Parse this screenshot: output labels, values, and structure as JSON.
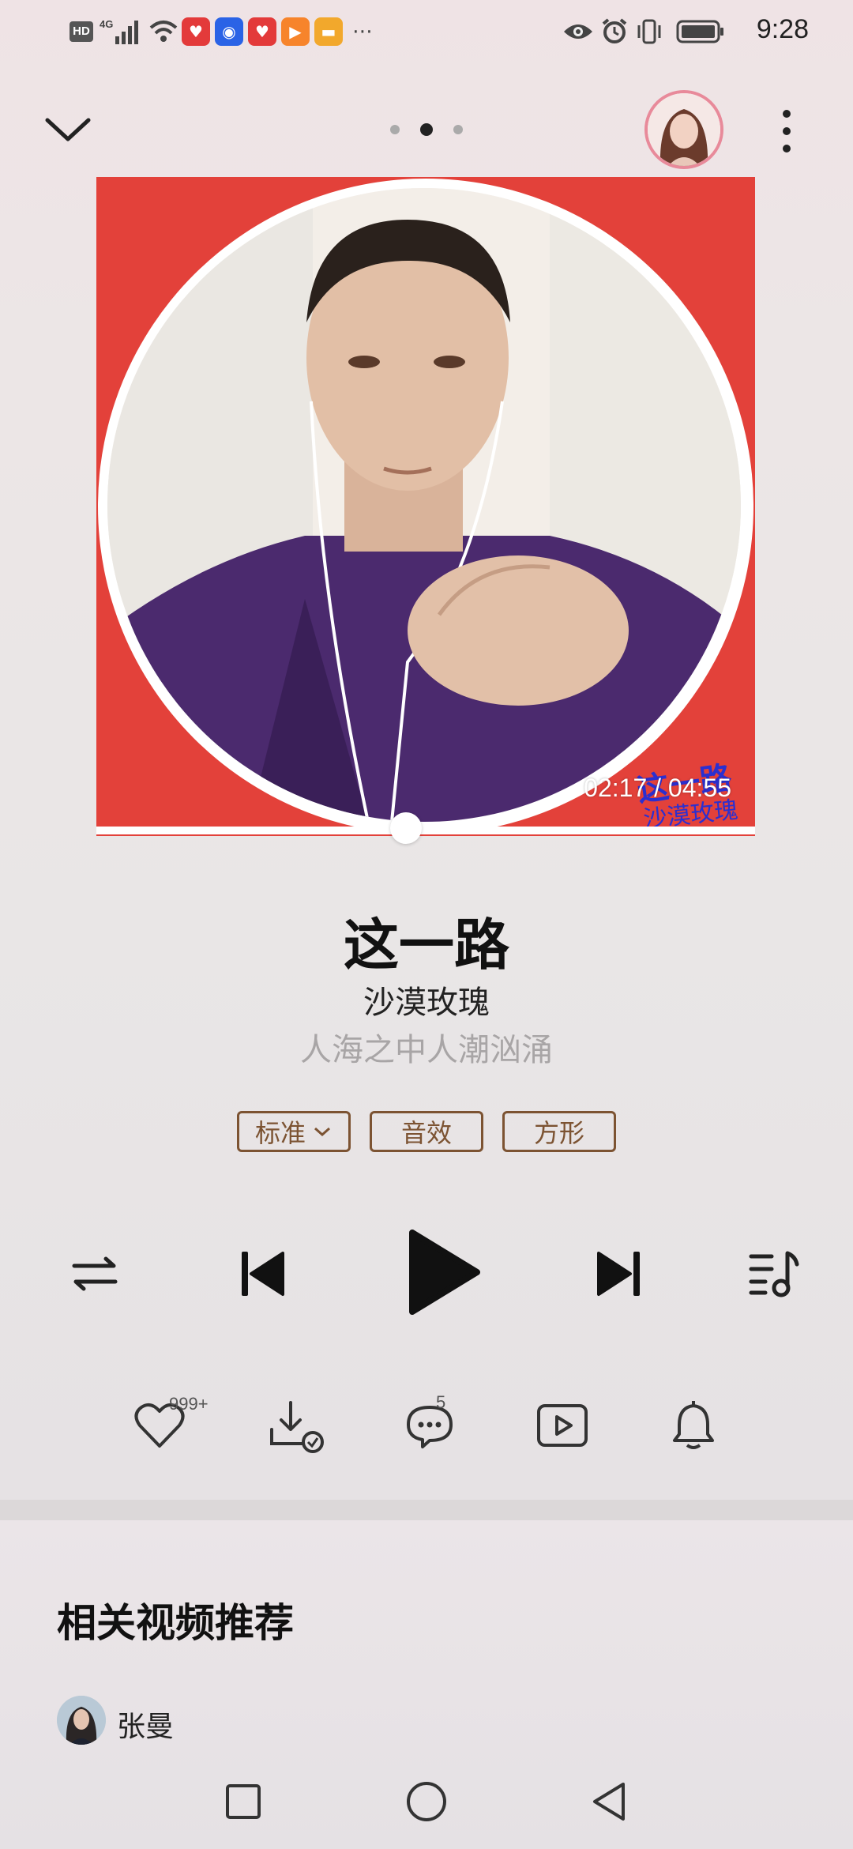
{
  "status_bar": {
    "time": "9:28",
    "network": "4G",
    "hd": "HD"
  },
  "header": {
    "page_dots": 3,
    "active_dot": 1
  },
  "player": {
    "album_overlay_title": "这一路",
    "album_signature": "沙漠玫瑰",
    "time_readout": "02:17 / 04:55",
    "progress": 0.47,
    "song_title": "这一路",
    "artist": "沙漠玫瑰",
    "lyric": "人海之中人潮汹涌",
    "tags": {
      "quality": "标准",
      "effect": "音效",
      "shape": "方形"
    }
  },
  "actions": {
    "like_count": "999+",
    "comment_count": "5"
  },
  "related": {
    "title": "相关视频推荐",
    "uploader": "张曼"
  },
  "colors": {
    "accent_brown": "#7c5332",
    "album_red": "#e3413a",
    "avatar_ring": "#e88a9a",
    "overlay_blue": "#2b2fd0"
  },
  "icons": {
    "collapse": "chevron-down-icon",
    "more": "more-vertical-icon",
    "repeat": "repeat-icon",
    "prev": "skip-previous-icon",
    "play": "play-icon",
    "next": "skip-next-icon",
    "playlist": "playlist-icon",
    "like": "heart-icon",
    "download": "download-icon",
    "comment": "comment-icon",
    "video": "video-icon",
    "ringtone": "bell-icon"
  }
}
